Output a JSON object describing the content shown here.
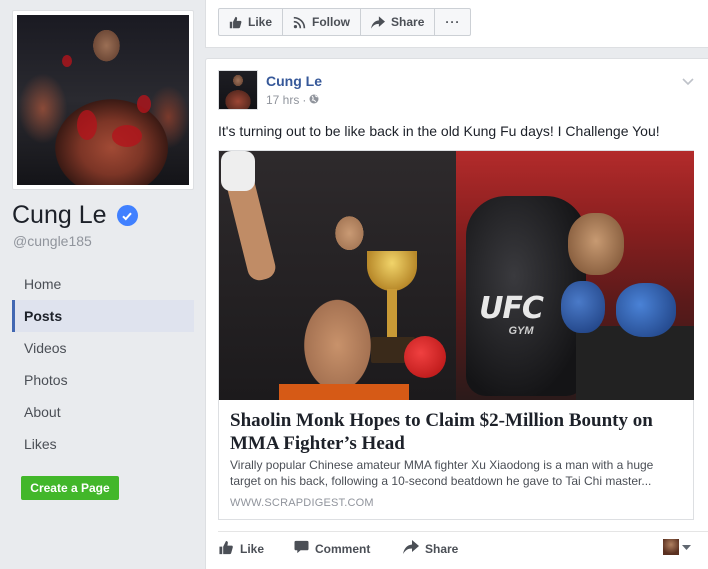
{
  "profile": {
    "name": "Cung Le",
    "username": "@cungle185"
  },
  "nav": {
    "items": [
      {
        "label": "Home"
      },
      {
        "label": "Posts"
      },
      {
        "label": "Videos"
      },
      {
        "label": "Photos"
      },
      {
        "label": "About"
      },
      {
        "label": "Likes"
      }
    ],
    "active": "Posts"
  },
  "create_page_label": "Create a Page",
  "page_actions": {
    "like": "Like",
    "follow": "Follow",
    "share": "Share",
    "more": "···"
  },
  "post": {
    "author": "Cung Le",
    "time": "17 hrs",
    "separator": "·",
    "text": "It's turning out to be like back in the old Kung Fu days! I Challenge You!",
    "link": {
      "image_text": "UFC",
      "image_subtext": "GYM",
      "title": "Shaolin Monk Hopes to Claim $2-Million Bounty on MMA Fighter’s Head",
      "description": "Virally popular Chinese amateur MMA fighter Xu Xiaodong is a man with a huge target on his back, following a 10-second beatdown he gave to Tai Chi master...",
      "domain": "WWW.SCRAPDIGEST.COM"
    },
    "actions": {
      "like": "Like",
      "comment": "Comment",
      "share": "Share"
    }
  },
  "colors": {
    "link_blue": "#365899",
    "nav_active_border": "#4267b2",
    "verified": "#4080ff",
    "create_button": "#42b72a",
    "background": "#e9ebee"
  }
}
